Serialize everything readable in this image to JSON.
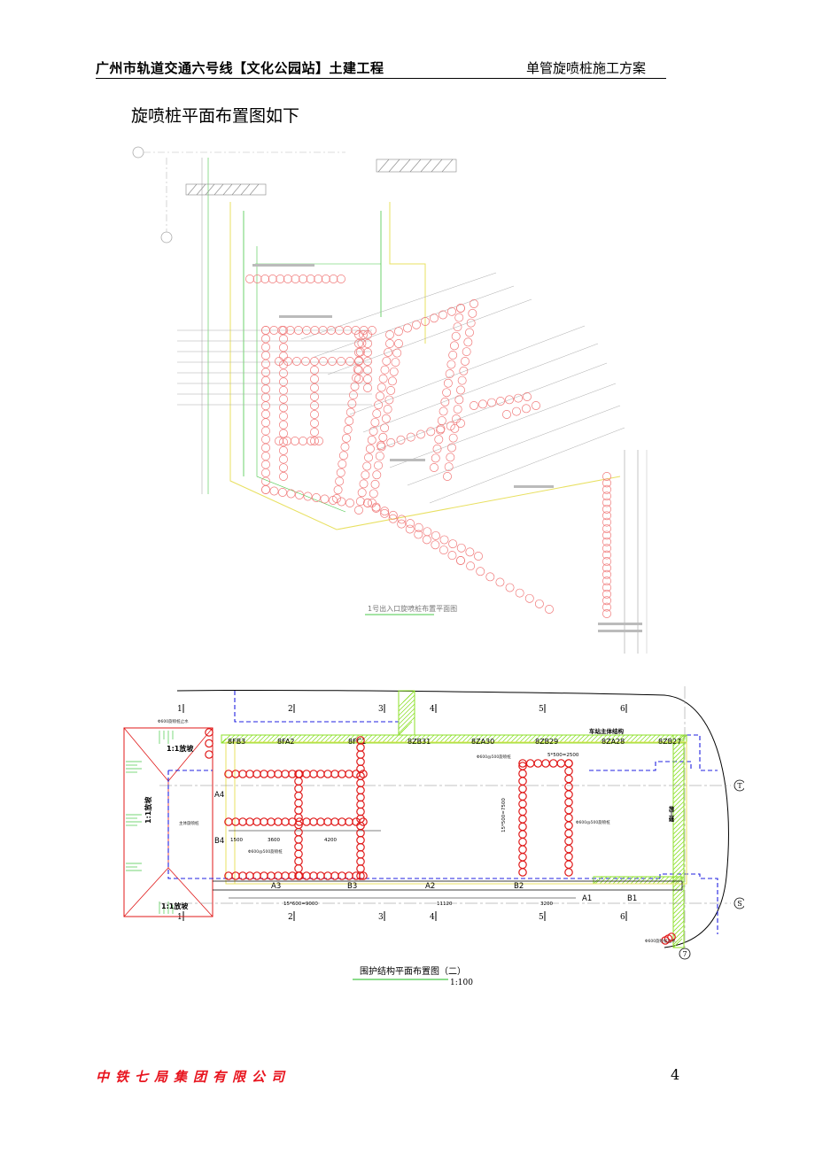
{
  "header": {
    "project": "广州市轨道交通六号线【文化公园站】土建工程",
    "doc_title": "单管旋喷桩施工方案"
  },
  "intro": "旋喷桩平面布置图如下",
  "figure1": {
    "caption": "1号出入口旋喷桩布置平面图",
    "pile_color": "#f07878",
    "line_color": "#48c848"
  },
  "figure2": {
    "caption": "围护结构平面布置图（二）",
    "scale": "1:100",
    "grid_top": [
      "1",
      "2",
      "3",
      "4",
      "5",
      "6"
    ],
    "grid_bottom": [
      "1",
      "2",
      "3",
      "4",
      "5",
      "6"
    ],
    "axis_markers": [
      "T",
      "S",
      "7"
    ],
    "wall_labels": [
      "8FB3",
      "8FA2",
      "8FC1",
      "8ZB31",
      "8ZA30",
      "8ZB29",
      "8ZA28",
      "8ZB27"
    ],
    "main_structure": "车站主体结构",
    "slope_top": "1:1放坡",
    "slope_left": "1:1放坡",
    "slope_bottom": "1:1放坡",
    "panel_labels": [
      "A4",
      "B4",
      "A3",
      "B3",
      "A2",
      "B2",
      "A1",
      "B1"
    ],
    "dims_middle": [
      "1500",
      "3600",
      "4200"
    ],
    "dims_bottom": [
      "15*600=9000",
      "11120",
      "3200"
    ],
    "dims_right": "5*500=2500",
    "dims_vertical": "15*500=7500",
    "pile_note": "Φ600@500旋喷桩",
    "pile_note_short": "Φ600旋喷桩止水",
    "construction_joint": "施工缝",
    "main_pile_label": "主体旋喷桩",
    "pile_color": "#e01818",
    "hatch_color": "#8ce028",
    "dash_color": "#2020e0"
  },
  "footer": {
    "company": "中铁七局集团有限公司",
    "page": "4"
  }
}
